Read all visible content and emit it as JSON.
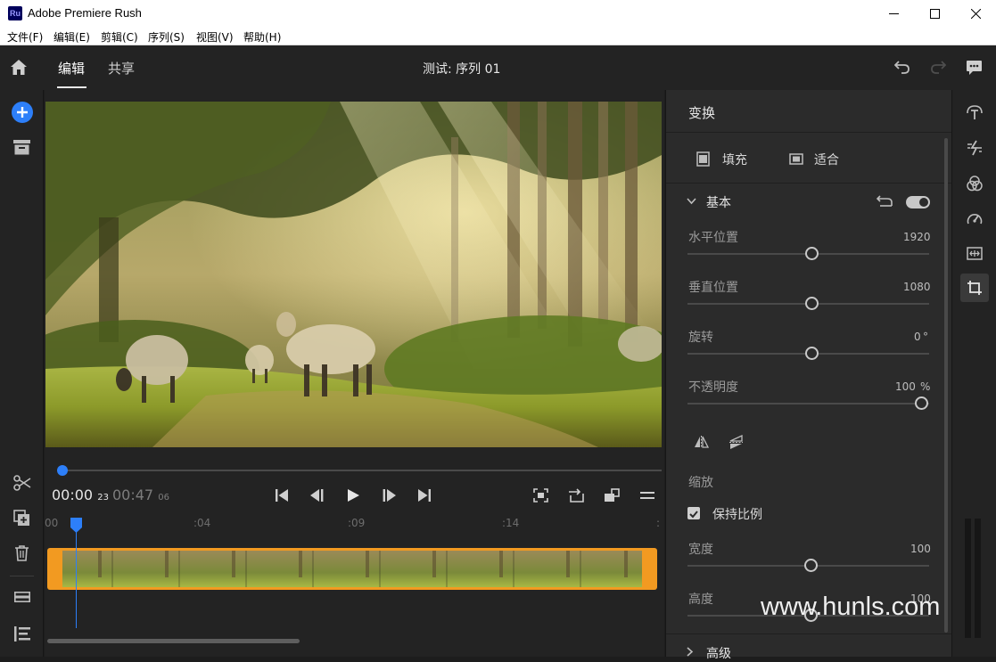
{
  "window": {
    "app_title": "Adobe Premiere Rush",
    "app_icon_text": "Ru"
  },
  "menu": [
    "文件(F)",
    "编辑(E)",
    "剪辑(C)",
    "序列(S)",
    "视图(V)",
    "帮助(H)"
  ],
  "header": {
    "tabs": [
      "编辑",
      "共享"
    ],
    "active_tab": "编辑",
    "sequence_title": "测试: 序列 01"
  },
  "player": {
    "current_time": "00:00",
    "current_frames": "23",
    "duration": "00:47",
    "duration_frames": "06",
    "ruler_labels": [
      "00",
      ":04",
      ":09",
      ":14",
      ":"
    ]
  },
  "panel": {
    "title": "变换",
    "fill_label": "填充",
    "fit_label": "适合",
    "section_basic": "基本",
    "props": [
      {
        "label": "水平位置",
        "value": "1920",
        "unit": ""
      },
      {
        "label": "垂直位置",
        "value": "1080",
        "unit": ""
      },
      {
        "label": "旋转",
        "value": "0",
        "unit": "°"
      },
      {
        "label": "不透明度",
        "value": "100",
        "unit": "%"
      }
    ],
    "scale_label": "缩放",
    "keep_ratio_label": "保持比例",
    "keep_ratio_checked": true,
    "width_label": "宽度",
    "width_value": "100",
    "height_label": "高度",
    "height_value": "100",
    "section_advanced": "高级"
  },
  "watermark": "www.hunls.com",
  "colors": {
    "accent": "#2d7ff9",
    "clip_border": "#f29a21",
    "panel_bg": "#2b2b2b"
  }
}
